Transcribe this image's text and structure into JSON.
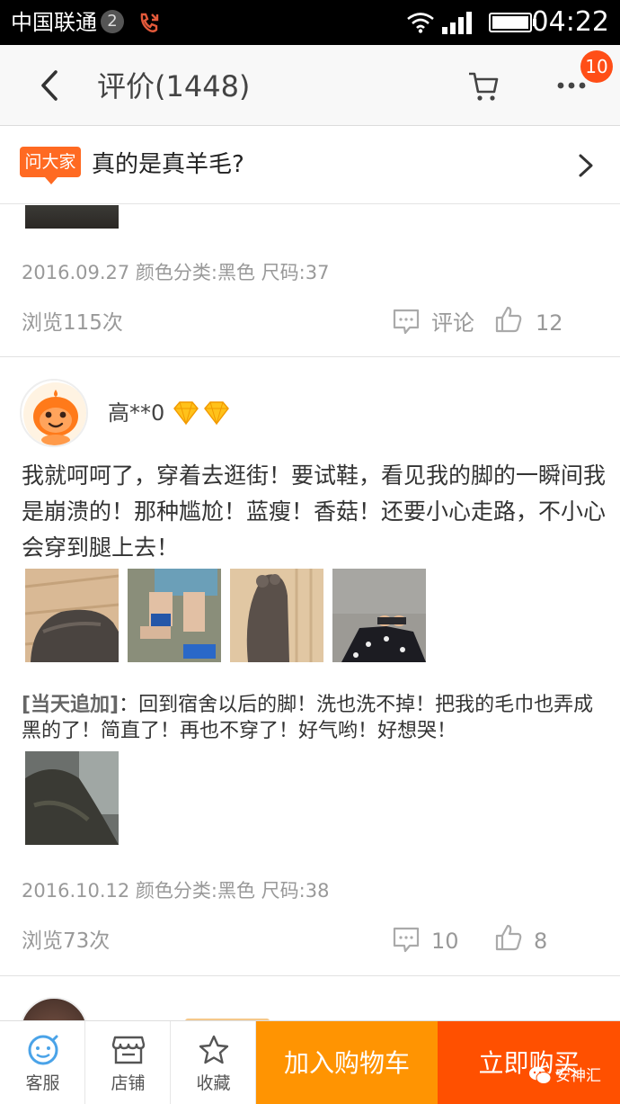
{
  "status_bar": {
    "carrier": "中国联通",
    "badge": "2",
    "time": "04:22"
  },
  "nav": {
    "title": "评价(1448)",
    "more_badge": "10"
  },
  "ask": {
    "tag": "问大家",
    "question": "真的是真羊毛?"
  },
  "review_prev": {
    "meta": "2016.09.27 颜色分类:黑色 尺码:37",
    "views": "浏览115次",
    "comment_label": "评论",
    "likes": "12"
  },
  "review": {
    "username": "高**0",
    "text": "我就呵呵了，穿着去逛街！要试鞋，看见我的脚的一瞬间我是崩溃的！那种尴尬！蓝瘦！香菇！还要小心走路，不小心会穿到腿上去！",
    "followup_label": "[当天追加]",
    "followup_text": "：回到宿舍以后的脚！洗也洗不掉！把我的毛巾也弄成黑的了！简直了！再也不穿了！好气哟！好想哭！",
    "meta": "2016.10.12 颜色分类:黑色 尺码:38",
    "views": "浏览73次",
    "comments": "10",
    "likes": "8"
  },
  "bottom_bar": {
    "service": "客服",
    "shop": "店铺",
    "favorite": "收藏",
    "add_cart": "加入购物车",
    "buy_now": "立即购买"
  },
  "watermark": "安神汇",
  "colors": {
    "accent_orange": "#ff9402",
    "accent_red": "#ff5000",
    "badge": "#ff4e17"
  }
}
